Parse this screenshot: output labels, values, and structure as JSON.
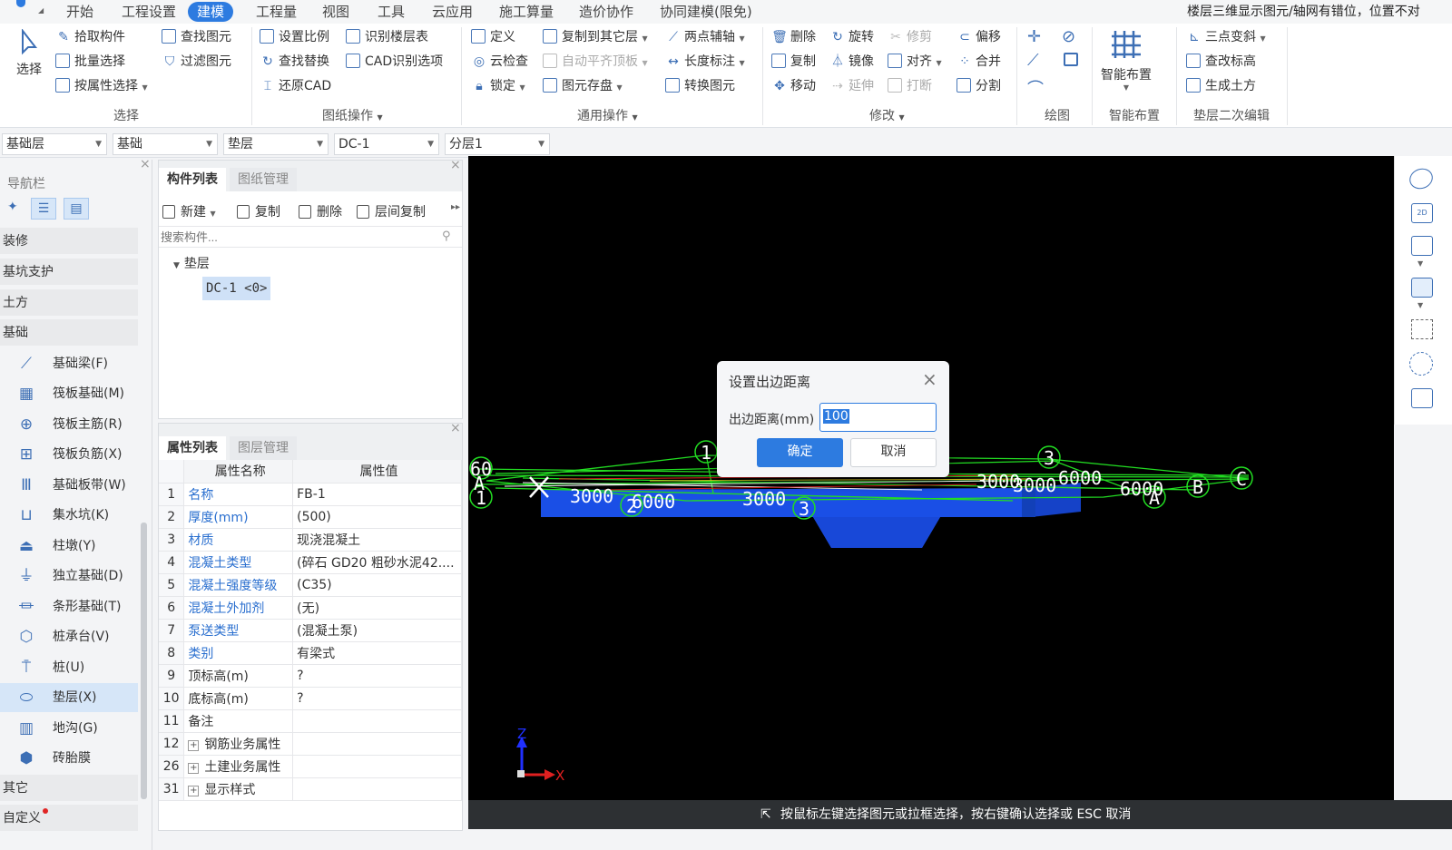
{
  "menu": {
    "items": [
      "开始",
      "工程设置",
      "建模",
      "工程量",
      "视图",
      "工具",
      "云应用",
      "施工算量",
      "造价协作",
      "协同建模(限免)"
    ],
    "active_index": 2,
    "right_notice": "楼层三维显示图元/轴网有错位，位置不对"
  },
  "ribbon": {
    "select": {
      "big_label": "选择",
      "items": [
        "拾取构件",
        "批量选择",
        "按属性选择",
        "查找图元",
        "过滤图元"
      ],
      "group": "选择"
    },
    "drawing_ops": {
      "items": [
        "设置比例",
        "查找替换",
        "还原CAD",
        "识别楼层表",
        "CAD识别选项"
      ],
      "group": "图纸操作"
    },
    "common_ops": {
      "items": [
        "定义",
        "云检查",
        "锁定",
        "复制到其它层",
        "自动平齐顶板",
        "图元存盘",
        "两点辅轴",
        "长度标注",
        "转换图元"
      ],
      "group": "通用操作"
    },
    "modify": {
      "items": [
        "删除",
        "复制",
        "移动",
        "旋转",
        "镜像",
        "延伸",
        "修剪",
        "对齐",
        "打断",
        "偏移",
        "合并",
        "分割"
      ],
      "group": "修改"
    },
    "draw": {
      "group": "绘图"
    },
    "smart": {
      "big_label": "智能布置",
      "group": "智能布置"
    },
    "secondary": {
      "items": [
        "三点变斜",
        "查改标高",
        "生成土方"
      ],
      "group": "垫层二次编辑"
    }
  },
  "combos": [
    "基础层",
    "基础",
    "垫层",
    "DC-1",
    "分层1"
  ],
  "nav": {
    "title": "导航栏",
    "categories_top": [
      "装修",
      "基坑支护",
      "土方",
      "基础"
    ],
    "items": [
      "基础梁(F)",
      "筏板基础(M)",
      "筏板主筋(R)",
      "筏板负筋(X)",
      "基础板带(W)",
      "集水坑(K)",
      "柱墩(Y)",
      "独立基础(D)",
      "条形基础(T)",
      "桩承台(V)",
      "桩(U)",
      "垫层(X)",
      "地沟(G)",
      "砖胎膜"
    ],
    "selected_index": 11,
    "categories_bottom": [
      "其它",
      "自定义"
    ]
  },
  "component_panel": {
    "tabs": [
      "构件列表",
      "图纸管理"
    ],
    "toolbar": [
      "新建",
      "复制",
      "删除",
      "层间复制"
    ],
    "search_placeholder": "搜索构件...",
    "tree_root": "垫层",
    "tree_item": "DC-1 <0>"
  },
  "property_panel": {
    "tabs": [
      "属性列表",
      "图层管理"
    ],
    "headers": [
      "属性名称",
      "属性值"
    ],
    "rows": [
      {
        "num": "1",
        "name": "名称",
        "value": "FB-1",
        "blue": true
      },
      {
        "num": "2",
        "name": "厚度(mm)",
        "value": "(500)",
        "blue": true
      },
      {
        "num": "3",
        "name": "材质",
        "value": "现浇混凝土",
        "blue": true
      },
      {
        "num": "4",
        "name": "混凝土类型",
        "value": "(碎石 GD20 粗砂水泥42....",
        "blue": true
      },
      {
        "num": "5",
        "name": "混凝土强度等级",
        "value": "(C35)",
        "blue": true
      },
      {
        "num": "6",
        "name": "混凝土外加剂",
        "value": "(无)",
        "blue": true
      },
      {
        "num": "7",
        "name": "泵送类型",
        "value": "(混凝土泵)",
        "blue": true
      },
      {
        "num": "8",
        "name": "类别",
        "value": "有梁式",
        "blue": true
      },
      {
        "num": "9",
        "name": "顶标高(m)",
        "value": "?",
        "blue": false
      },
      {
        "num": "10",
        "name": "底标高(m)",
        "value": "?",
        "blue": false
      },
      {
        "num": "11",
        "name": "备注",
        "value": "",
        "blue": false
      },
      {
        "num": "12",
        "name": "钢筋业务属性",
        "value": "",
        "blue": false,
        "expand": true
      },
      {
        "num": "26",
        "name": "土建业务属性",
        "value": "",
        "blue": false,
        "expand": true
      },
      {
        "num": "31",
        "name": "显示样式",
        "value": "",
        "blue": false,
        "expand": true
      }
    ]
  },
  "viewport": {
    "dims": [
      "3000",
      "6000",
      "3000",
      "6000",
      "6000",
      "3000",
      "3000"
    ],
    "axis_labels": [
      "1",
      "2",
      "3",
      "1",
      "3",
      "A",
      "B",
      "C",
      "A"
    ],
    "edge_labels": [
      "60",
      "A",
      "1"
    ],
    "z": "Z",
    "x": "X"
  },
  "dialog": {
    "title": "设置出边距离",
    "field_label": "出边距离(mm)",
    "field_value": "100",
    "ok": "确定",
    "cancel": "取消"
  },
  "status": "按鼠标左键选择图元或拉框选择，按右键确认选择或 ESC 取消",
  "colors": {
    "accent": "#2d7be0",
    "viewport": "#000000",
    "slab": "#1a4fe6"
  }
}
